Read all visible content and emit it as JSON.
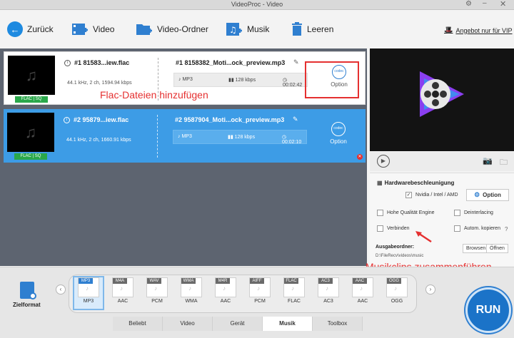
{
  "window": {
    "title": "VideoProc - Video"
  },
  "toolbar": {
    "back": "Zurück",
    "video": "Video",
    "video_folder": "Video-Ordner",
    "music": "Musik",
    "clear": "Leeren",
    "vip": "Angebot nur für VIP"
  },
  "items": [
    {
      "source_name": "#1 81583...iew.flac",
      "source_meta": "44.1 kHz, 2 ch, 1594.94 kbps",
      "badge": "FLAC | SQ",
      "output_name": "#1 8158382_Moti...ock_preview.mp3",
      "format": "MP3",
      "bitrate": "128 kbps",
      "duration": "00:02:42",
      "codec": "codec",
      "option": "Option"
    },
    {
      "source_name": "#2 95879...iew.flac",
      "source_meta": "44.1 kHz, 2 ch, 1660.91 kbps",
      "badge": "FLAC | SQ",
      "output_name": "#2 9587904_Moti...ock_preview.mp3",
      "format": "MP3",
      "bitrate": "128 kbps",
      "duration": "00:02:10",
      "codec": "codec",
      "option": "Option"
    }
  ],
  "annotations": {
    "add_flac": "Flac-Dateien hinzufügen",
    "merge_music": "Musikclips zusammenführen"
  },
  "settings": {
    "hw_title": "Hardwarebeschleunigung",
    "hw_vendor": "Nvidia / Intel / AMD",
    "hw_vendor_checked": true,
    "option_button": "Option",
    "high_quality": "Hohe Qualität Engine",
    "deinterlacing": "Deinterlacing",
    "merge": "Verbinden",
    "auto_copy": "Autom. kopieren",
    "output_label": "Ausgabeordner:",
    "output_path": "D:\\FileRecv\\videos\\music",
    "browse": "Browsen",
    "open": "Öffnen"
  },
  "formats": {
    "label": "Zielformat",
    "items": [
      {
        "tag": "MP3",
        "name": "MP3",
        "selected": true
      },
      {
        "tag": "M4A",
        "name": "AAC"
      },
      {
        "tag": "WAV",
        "name": "PCM"
      },
      {
        "tag": "WMA",
        "name": "WMA"
      },
      {
        "tag": "M4R",
        "name": "AAC"
      },
      {
        "tag": "AIFF",
        "name": "PCM"
      },
      {
        "tag": "FLAC",
        "name": "FLAC"
      },
      {
        "tag": "AC3",
        "name": "AC3"
      },
      {
        "tag": "AAC",
        "name": "AAC"
      },
      {
        "tag": "OGG",
        "name": "OGG"
      }
    ]
  },
  "tabs": [
    "Beliebt",
    "Video",
    "Gerät",
    "Musik",
    "Toolbox"
  ],
  "active_tab": "Musik",
  "run": "RUN",
  "colors": {
    "accent": "#2f7fd0",
    "selected_row": "#3d9ce6",
    "annotation": "#e53030",
    "badge": "#2aa84a"
  }
}
